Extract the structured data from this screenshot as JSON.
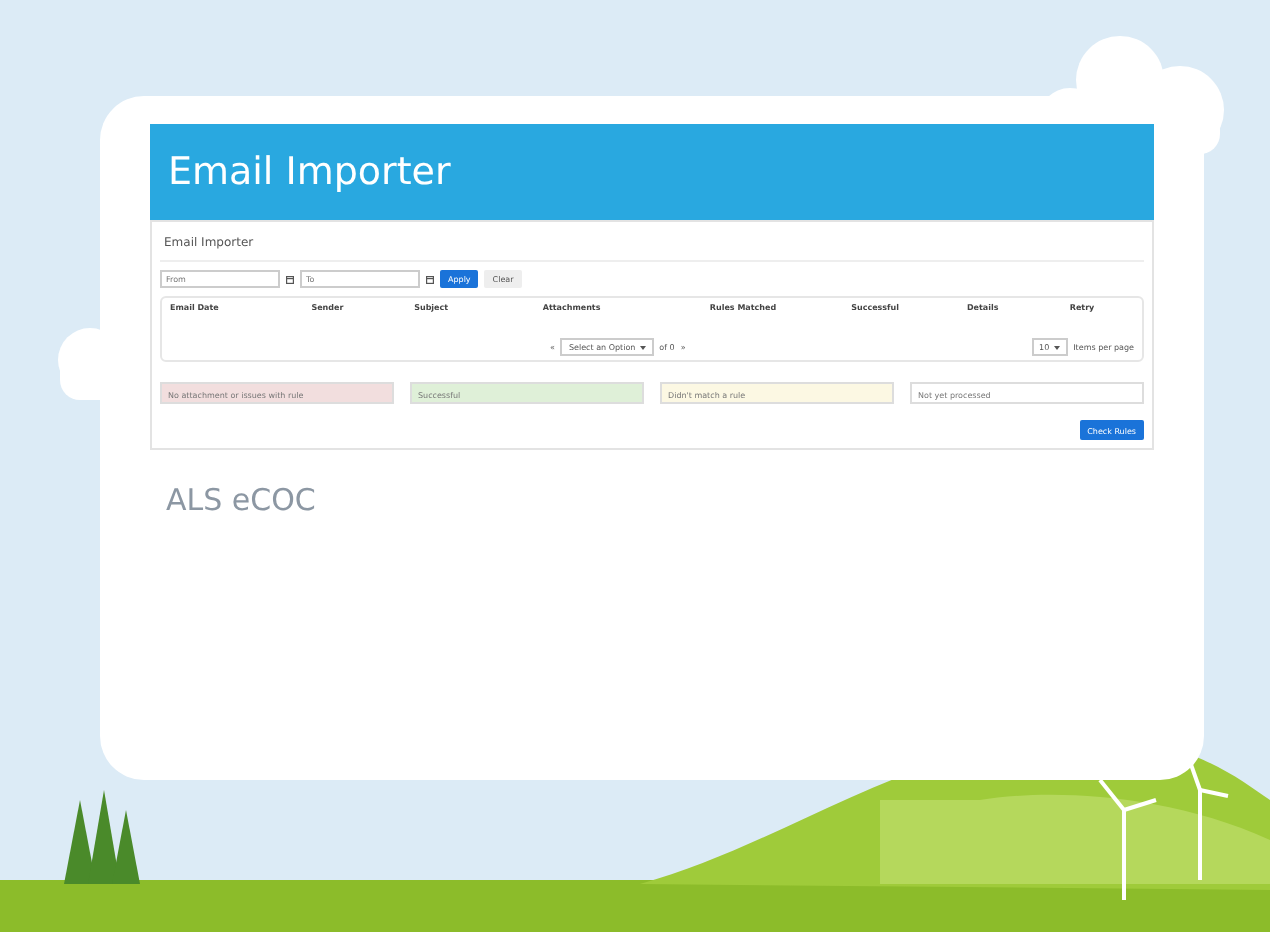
{
  "header": {
    "title": "Email Importer"
  },
  "panel": {
    "title": "Email Importer",
    "filters": {
      "from_placeholder": "From",
      "to_placeholder": "To",
      "buttons": [
        "Apply",
        "Clear"
      ]
    },
    "table": {
      "columns": [
        "Email Date",
        "Sender",
        "Subject",
        "Attachments",
        "Rules Matched",
        "Successful",
        "Details",
        "Retry"
      ]
    },
    "pager": {
      "prev": "«",
      "page_select": "Select an Option",
      "of": "of 0",
      "next": "»",
      "page_size": "10",
      "page_size_label": "Items per page"
    }
  },
  "legend": [
    {
      "label": "No attachment or issues with rule",
      "color": "#f2dede"
    },
    {
      "label": "Successful",
      "color": "#dff0d8"
    },
    {
      "label": "Didn't match a rule",
      "color": "#fcf8e3"
    },
    {
      "label": "Not yet processed",
      "color": "#ffffff"
    }
  ],
  "action_button": "Check Rules",
  "watermark_text": "ALS eCOC"
}
